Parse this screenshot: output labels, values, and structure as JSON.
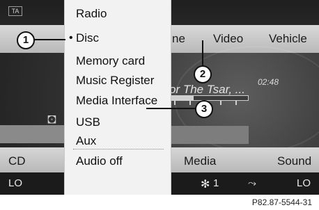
{
  "status": {
    "ta_badge": "TA"
  },
  "nav": {
    "item1_partial": "ne",
    "item2": "Video",
    "item3": "Vehicle"
  },
  "now_playing": {
    "title_partial": "or The Tsar, ...",
    "time": "02:48",
    "progress": 0.3
  },
  "source_menu": {
    "title": "Radio",
    "items": [
      "Disc",
      "Memory card",
      "Music Register",
      "Media Interface",
      "USB",
      "Aux",
      "Audio off"
    ],
    "selected_index": 0
  },
  "function_bar": {
    "left": "CD",
    "center": "Media",
    "right": "Sound"
  },
  "climate_bar": {
    "left_temp": "LO",
    "fan_level": "1",
    "right_temp": "LO"
  },
  "callouts": [
    "1",
    "2",
    "3"
  ],
  "figure_ref": "P82.87-5544-31"
}
